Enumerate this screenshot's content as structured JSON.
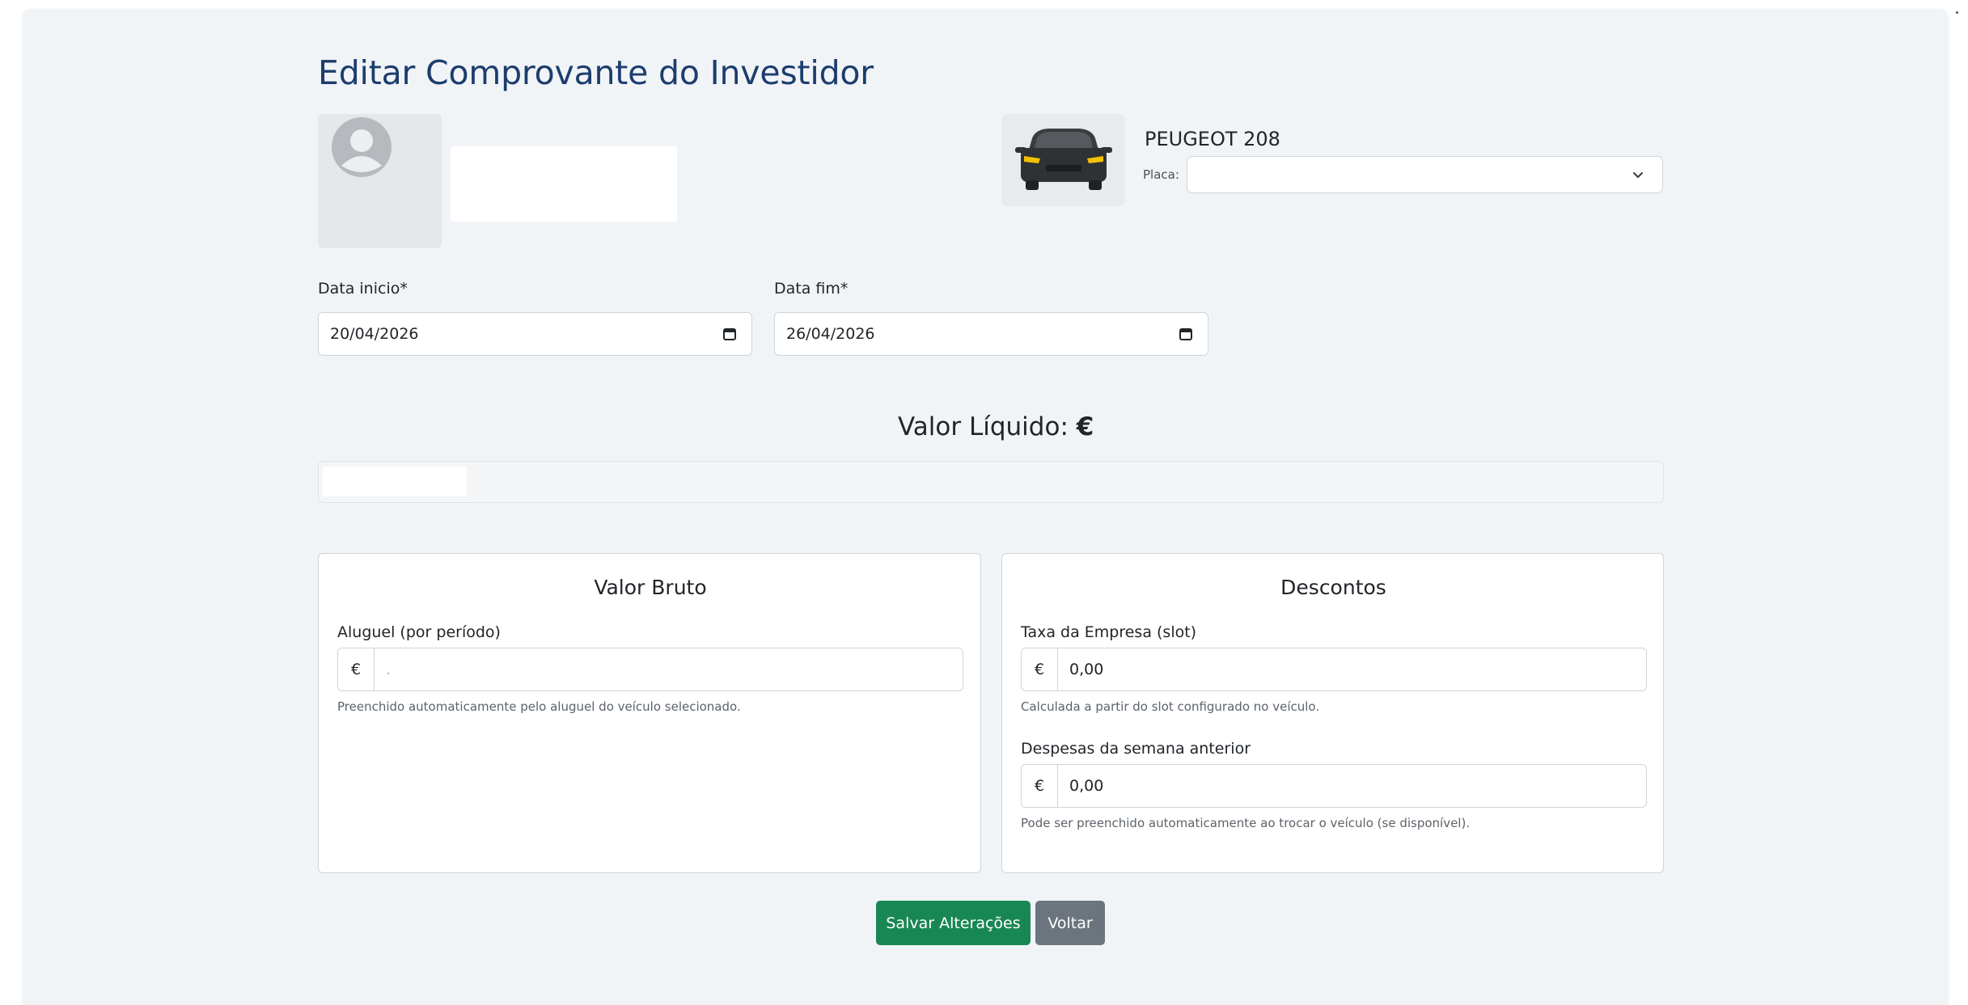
{
  "page": {
    "title": "Editar Comprovante do Investidor"
  },
  "vehicle": {
    "name": "PEUGEOT 208",
    "placa_label": "Placa:",
    "placa_value": ""
  },
  "dates": {
    "start_label": "Data inicio*",
    "start_value": "20/04/2026",
    "end_label": "Data fim*",
    "end_value": "26/04/2026"
  },
  "liquido": {
    "label": "Valor Líquido:",
    "currency": "€"
  },
  "valor_bruto": {
    "title": "Valor Bruto",
    "aluguel_label": "Aluguel (por período)",
    "currency": "€",
    "aluguel_value": ".",
    "aluguel_help": "Preenchido automaticamente pelo aluguel do veículo selecionado."
  },
  "descontos": {
    "title": "Descontos",
    "taxa_label": "Taxa da Empresa (slot)",
    "currency": "€",
    "taxa_value": "0,00",
    "taxa_help": "Calculada a partir do slot configurado no veículo.",
    "despesas_label": "Despesas da semana anterior",
    "despesas_value": "0,00",
    "despesas_help": "Pode ser preenchido automaticamente ao trocar o veículo (se disponível)."
  },
  "actions": {
    "save_label": "Salvar Alterações",
    "back_label": "Voltar"
  },
  "icons": {
    "avatar": "user-avatar-icon",
    "car": "car-icon",
    "calendar": "calendar-icon",
    "chevron": "chevron-down-icon"
  },
  "colors": {
    "title": "#1c3d6e",
    "save_button": "#198754",
    "back_button": "#6c757d",
    "panel_background": "#f1f4f7"
  }
}
